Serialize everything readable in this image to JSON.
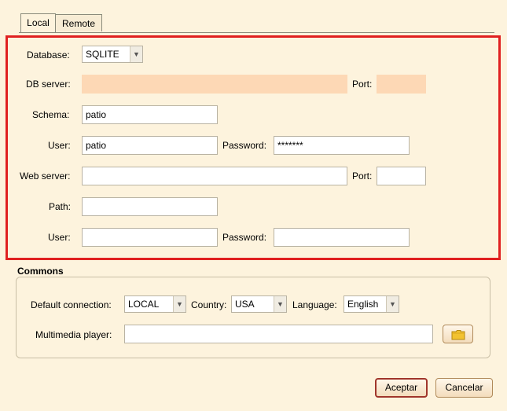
{
  "tabs": [
    {
      "label": "Local",
      "active": true
    },
    {
      "label": "Remote",
      "active": false
    }
  ],
  "local": {
    "database": {
      "label": "Database:",
      "value": "SQLITE"
    },
    "db_server": {
      "label": "DB server:",
      "value": "",
      "port_label": "Port:",
      "port_value": ""
    },
    "schema": {
      "label": "Schema:",
      "value": "patio"
    },
    "user": {
      "label": "User:",
      "value": "patio",
      "password_label": "Password:",
      "password_value": "*******"
    },
    "web_server": {
      "label": "Web server:",
      "value": "",
      "port_label": "Port:",
      "port_value": ""
    },
    "path": {
      "label": "Path:",
      "value": ""
    },
    "web_user": {
      "label": "User:",
      "value": "",
      "password_label": "Password:",
      "password_value": ""
    }
  },
  "commons": {
    "title": "Commons",
    "default_connection": {
      "label": "Default connection:",
      "value": "LOCAL"
    },
    "country": {
      "label": "Country:",
      "value": "USA"
    },
    "language": {
      "label": "Language:",
      "value": "English"
    },
    "multimedia_player": {
      "label": "Multimedia player:",
      "value": ""
    }
  },
  "buttons": {
    "accept": "Aceptar",
    "cancel": "Cancelar"
  },
  "colors": {
    "highlight_border": "#e02020",
    "disabled_field": "#fdd8b5",
    "background": "#fdf3dd"
  }
}
